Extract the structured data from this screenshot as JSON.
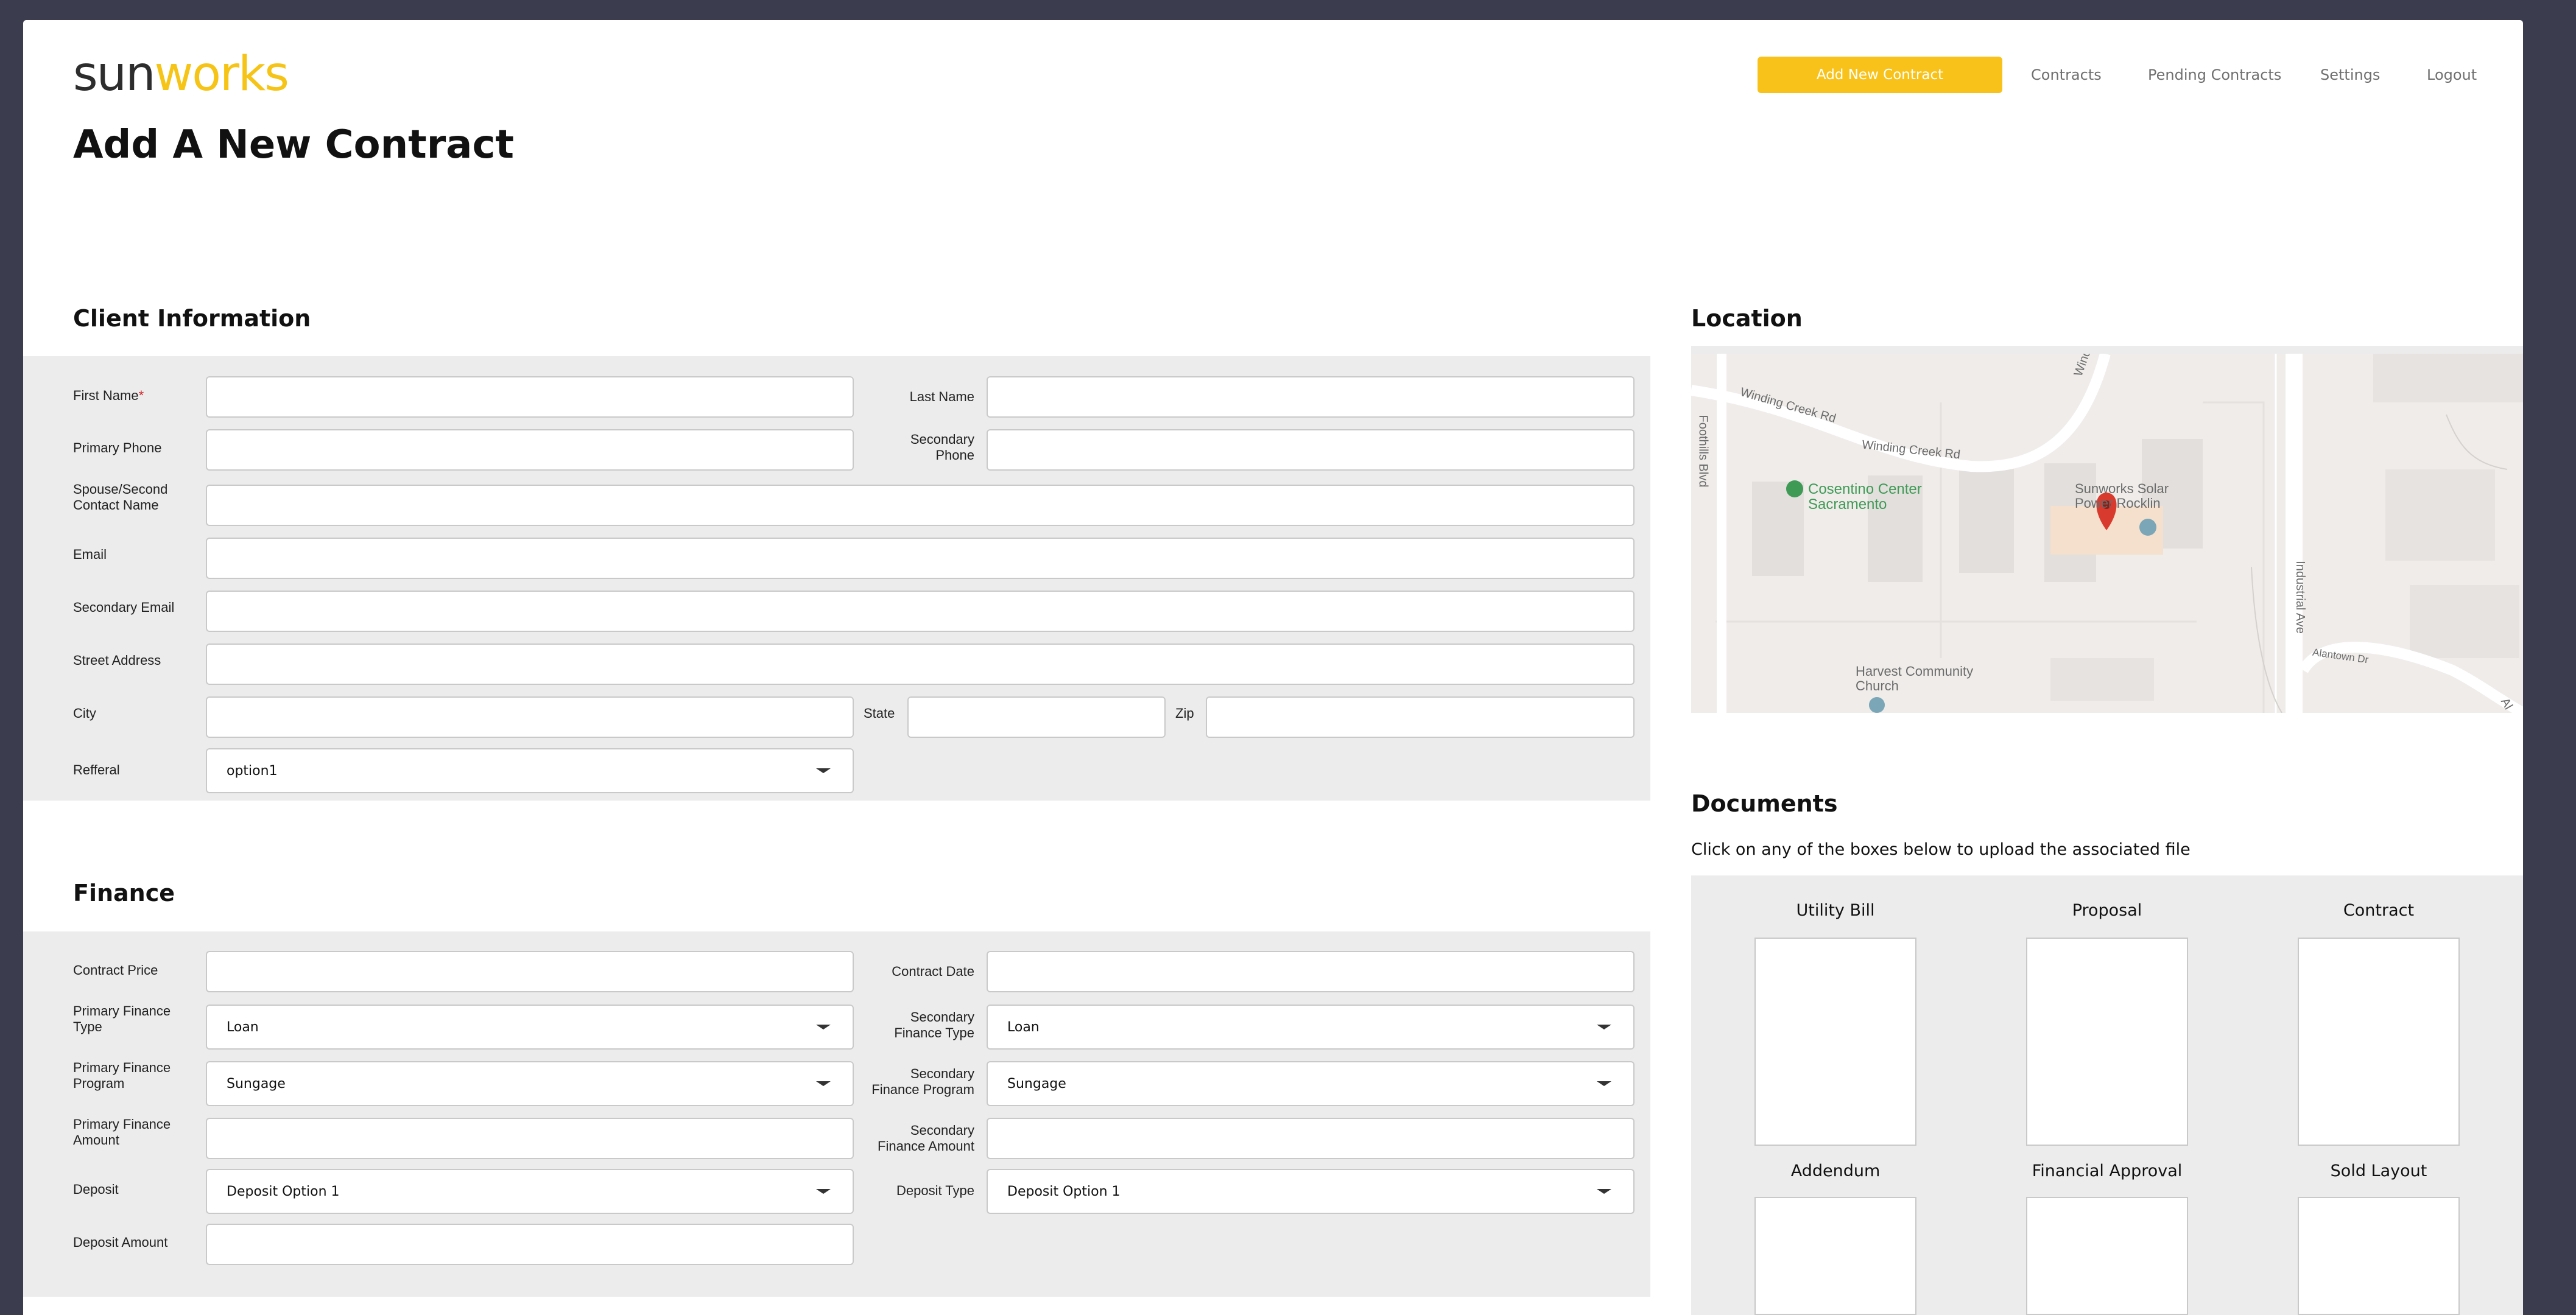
{
  "header": {
    "logo_part1": "sun",
    "logo_part2": "works",
    "primary_button": "Add New Contract",
    "nav": [
      "Contracts",
      "Pending Contracts",
      "Settings",
      "Logout"
    ]
  },
  "page_title": "Add A New Contract",
  "client_info": {
    "title": "Client Information",
    "first_name": "First Name",
    "first_name_required": "*",
    "last_name": "Last Name",
    "primary_phone": "Primary Phone",
    "secondary_phone": "Secondary Phone",
    "spouse": "Spouse/Second Contact Name",
    "email": "Email",
    "secondary_email": "Secondary Email",
    "street": "Street Address",
    "city": "City",
    "state": "State",
    "zip": "Zip",
    "referral": "Refferal",
    "referral_value": "option1"
  },
  "finance": {
    "title": "Finance",
    "contract_price": "Contract Price",
    "contract_date": "Contract Date",
    "primary_finance_type": "Primary Finance Type",
    "primary_finance_type_value": "Loan",
    "secondary_finance_type": "Secondary Finance Type",
    "secondary_finance_type_value": "Loan",
    "primary_finance_program": "Primary Finance Program",
    "primary_finance_program_value": "Sungage",
    "secondary_finance_program": "Secondary Finance Program",
    "secondary_finance_program_value": "Sungage",
    "primary_finance_amount": "Primary Finance Amount",
    "secondary_finance_amount": "Secondary Finance Amount",
    "deposit": "Deposit",
    "deposit_value": "Deposit Option 1",
    "deposit_type": "Deposit Type",
    "deposit_type_value": "Deposit Option 1",
    "deposit_amount": "Deposit Amount"
  },
  "location": {
    "title": "Location",
    "map_labels": {
      "winding_creek_1": "Winding Creek Rd",
      "winding_creek_2": "Winding Creek Rd",
      "foothills": "Foothills Blvd",
      "cosentino": "Cosentino Center Sacramento",
      "sunworks": "Sunworks Solar Power Rocklin",
      "industrial": "Industrial Ave",
      "harvest": "Harvest Community Church",
      "alantown": "Alantown Dr",
      "wind": "Wind",
      "al": "Al"
    }
  },
  "documents": {
    "title": "Documents",
    "subtitle": "Click on any of the boxes below to upload the associated file",
    "items": [
      "Utility Bill",
      "Proposal",
      "Contract",
      "Addendum",
      "Financial Approval",
      "Sold Layout"
    ]
  }
}
